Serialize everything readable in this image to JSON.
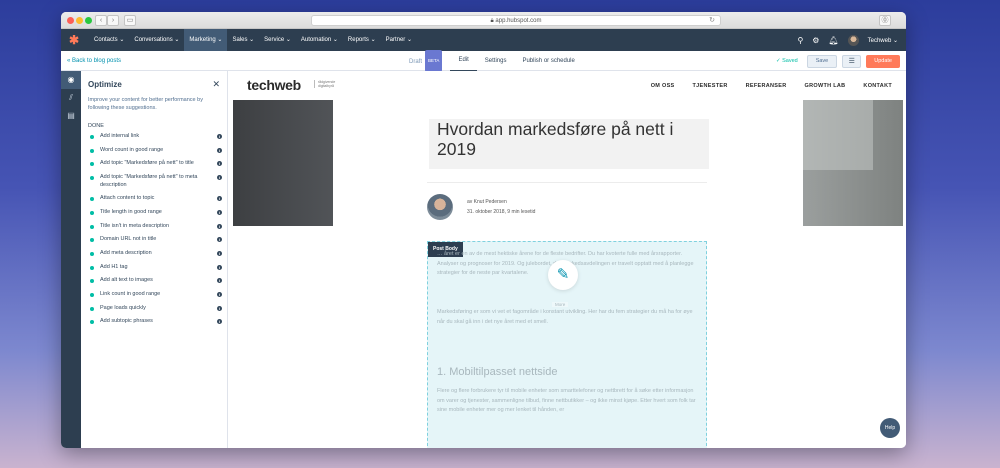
{
  "browser": {
    "url": "app.hubspot.com"
  },
  "hubspot_nav": {
    "items": [
      {
        "label": "Contacts ⌄"
      },
      {
        "label": "Conversations ⌄"
      },
      {
        "label": "Marketing ⌄",
        "active": true
      },
      {
        "label": "Sales ⌄"
      },
      {
        "label": "Service ⌄"
      },
      {
        "label": "Automation ⌄"
      },
      {
        "label": "Reports ⌄"
      },
      {
        "label": "Partner ⌄"
      }
    ],
    "account_name": "Techweb ⌄"
  },
  "editor_bar": {
    "back_link": "« Back to blog posts",
    "tabs": [
      {
        "label": "Draft",
        "badge": "BETA",
        "muted": true
      },
      {
        "label": "Edit",
        "active": true
      },
      {
        "label": "Settings"
      },
      {
        "label": "Publish or schedule"
      }
    ],
    "saved_label": "✓ Saved",
    "save_button": "Save",
    "update_button": "Update"
  },
  "optimize": {
    "title": "Optimize",
    "description": "Improve your content for better performance by following these suggestions.",
    "done_heading": "DONE",
    "items": [
      {
        "label": "Add internal link"
      },
      {
        "label": "Word count in good range"
      },
      {
        "label": "Add topic \"Markedsføre på nett\" to title"
      },
      {
        "label": "Add topic \"Markedsføre på nett\" to meta description"
      },
      {
        "label": "Attach content to topic"
      },
      {
        "label": "Title length in good range"
      },
      {
        "label": "Title isn't in meta description"
      },
      {
        "label": "Domain URL not in title"
      },
      {
        "label": "Add meta description"
      },
      {
        "label": "Add H1 tag"
      },
      {
        "label": "Add alt text to images"
      },
      {
        "label": "Link count in good range"
      },
      {
        "label": "Page loads quickly"
      },
      {
        "label": "Add subtopic phrases"
      }
    ]
  },
  "site": {
    "logo": "techweb",
    "tagline": "rådgivende digitalbyrå",
    "menu": [
      "OM OSS",
      "TJENESTER",
      "REFERANSER",
      "GROWTH LAB",
      "KONTAKT"
    ]
  },
  "article": {
    "title": "Hvordan markedsføre på nett i 2019",
    "author": "av Knut Pedersen",
    "date": "31. oktober 2018, 9 min lesetid",
    "post_body_label": "Post Body",
    "more_label": "More",
    "para1": "… året er en av de mest hektiske årene for de fleste bedrifter. Du har kvoterte fulle med årsrapporter. Analyser og prognoser for 2019. Og julebordet, da. Markedsavdelingen er travelt opptatt med å planlegge strategier for de neste par kvartalene.",
    "para2": "Markedsføring er som vi vet et fagområde i konstant utvikling. Her har du fem strategier du må ha for øye når du skal gå inn i det nye året med et smell.",
    "heading": "1. Mobiltilpasset nettside",
    "para3": "Flere og flere forbrukere tyr til mobile enheter som smarttelefoner og nettbrett for å søke etter informasjon om varer og tjenester, sammenligne tilbud, finne nettbutikker – og ikke minst kjøpe. Etter hvert som folk tar sine mobile enheter mer og mer lenket til hånden, er"
  },
  "help_label": "Help"
}
